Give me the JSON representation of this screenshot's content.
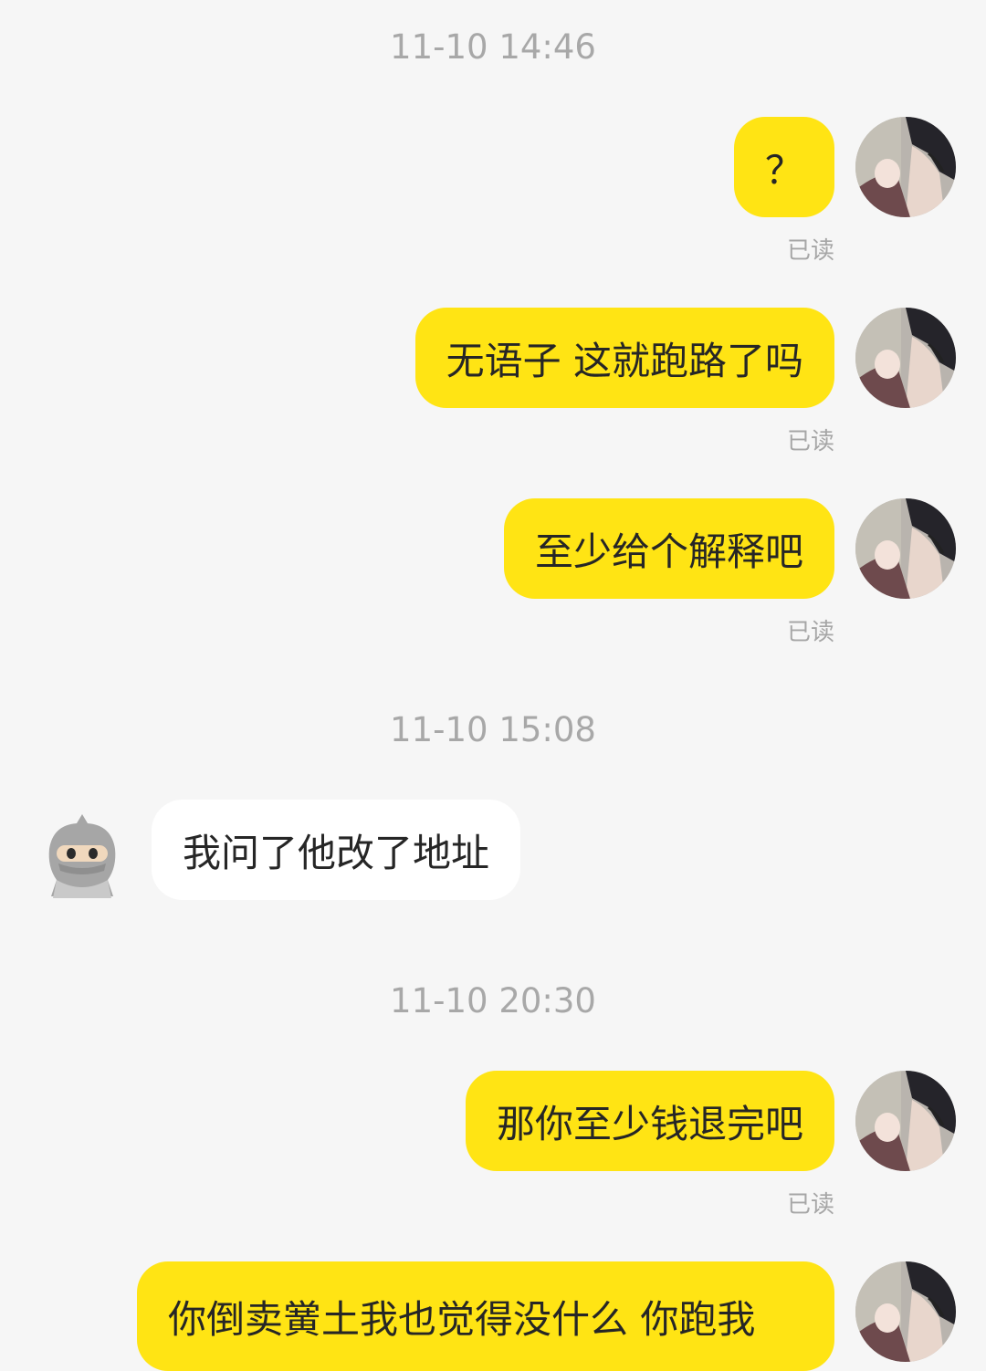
{
  "colors": {
    "background": "#f6f6f6",
    "outgoing_bubble": "#ffe414",
    "incoming_bubble": "#ffffff",
    "timestamp_text": "#a8a8a8",
    "read_receipt_text": "#a6a6a6"
  },
  "chat": {
    "timestamps": [
      "11-10 14:46",
      "11-10 15:08",
      "11-10 20:30"
    ],
    "messages": [
      {
        "direction": "outgoing",
        "text": "？",
        "status": "已读"
      },
      {
        "direction": "outgoing",
        "text": "无语子 这就跑路了吗",
        "status": "已读"
      },
      {
        "direction": "outgoing",
        "text": "至少给个解释吧",
        "status": "已读"
      },
      {
        "direction": "incoming",
        "text": "我问了他改了地址"
      },
      {
        "direction": "outgoing",
        "text": "那你至少钱退完吧",
        "status": "已读"
      },
      {
        "direction": "outgoing",
        "text": "你倒卖黉土我也觉得没什么 你跑我"
      }
    ]
  },
  "avatars": {
    "self": "anime-boy-avatar",
    "peer": "hooded-ninja-avatar"
  }
}
